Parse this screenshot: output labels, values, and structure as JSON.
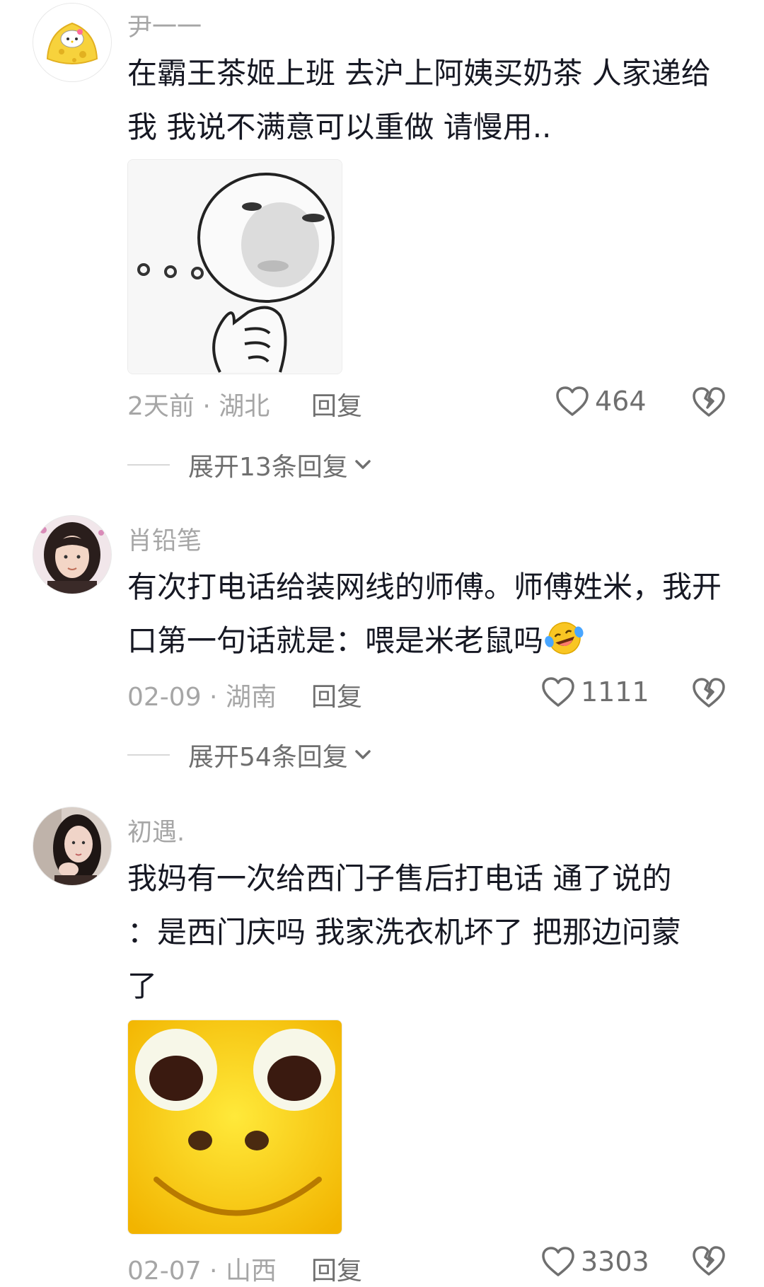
{
  "comments": [
    {
      "username": "尹一一",
      "text": "在霸王茶姬上班 去沪上阿姨买奶茶 人家递给我 我说不满意可以重做 请慢用..",
      "time": "2天前",
      "location": "湖北",
      "reply_label": "回复",
      "likes": "464",
      "expand_label": "展开13条回复",
      "avatar_icon": "hello-kitty-cheese-avatar",
      "sticker": "thinking-face-sticker"
    },
    {
      "username": "肖铅笔",
      "text": "有次打电话给装网线的师傅。师傅姓米，我开口第一句话就是：喂是米老鼠吗",
      "emoji": "laughing-crying-emoji",
      "time": "02-09",
      "location": "湖南",
      "reply_label": "回复",
      "likes": "1111",
      "expand_label": "展开54条回复",
      "avatar_icon": "girl-portrait-avatar"
    },
    {
      "username": "初遇.",
      "text_line1": "我妈有一次给西门子售后打电话 通了说的",
      "text_line2": "：是西门庆吗 我家洗衣机坏了 把那边问蒙",
      "text_line3": "了",
      "time": "02-07",
      "location": "山西",
      "reply_label": "回复",
      "likes": "3303",
      "avatar_icon": "woman-portrait-avatar",
      "sticker": "yellow-frog-face-sticker"
    }
  ],
  "separator": " · ",
  "colors": {
    "meta": "#a6a6a6",
    "text": "#161823",
    "action": "#6f6f6f"
  }
}
